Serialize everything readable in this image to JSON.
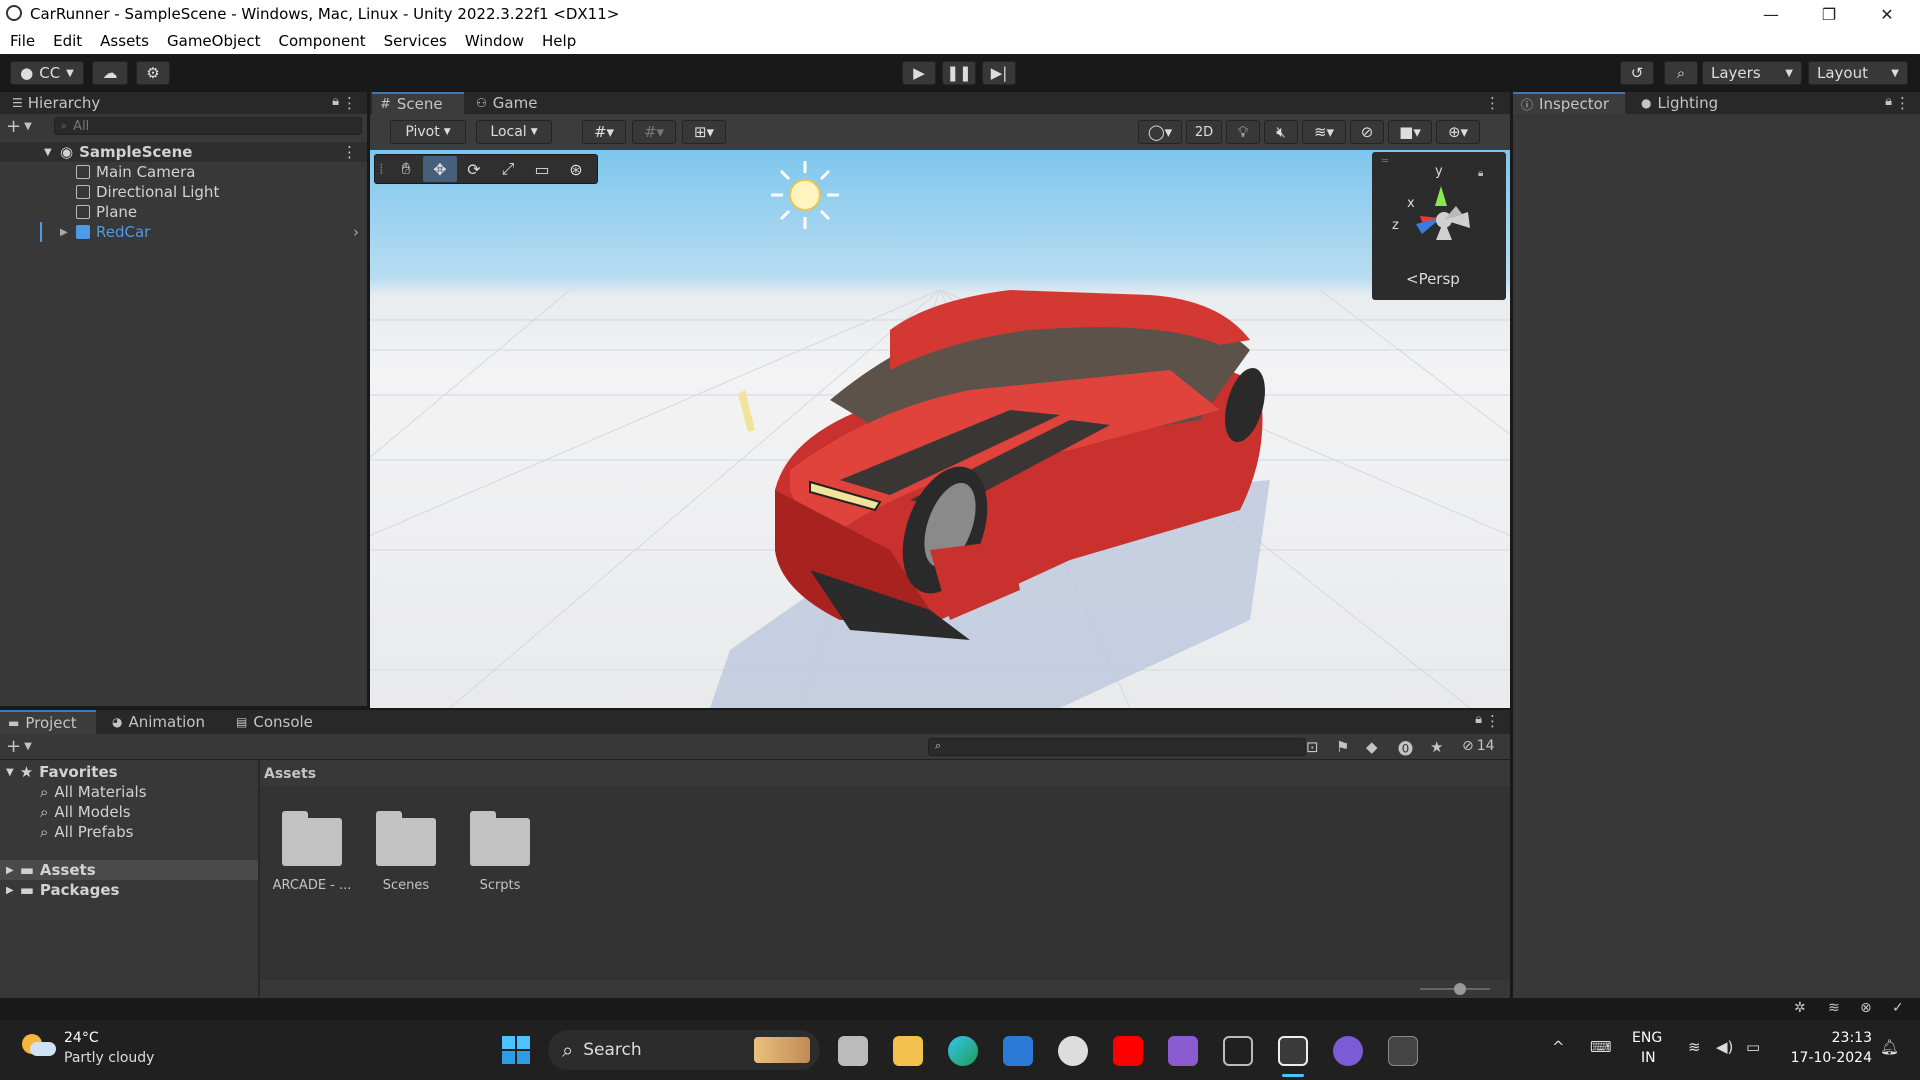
{
  "window": {
    "title": "CarRunner - SampleScene - Windows, Mac, Linux - Unity 2022.3.22f1 <DX11>",
    "minimize": "—",
    "maximize": "❐",
    "close": "✕"
  },
  "menu": [
    "File",
    "Edit",
    "Assets",
    "GameObject",
    "Component",
    "Services",
    "Window",
    "Help"
  ],
  "toolbar": {
    "account": "CC",
    "layers": "Layers",
    "layout": "Layout",
    "play_icon": "play-icon",
    "pause_icon": "pause-icon",
    "step_icon": "step-icon"
  },
  "hierarchy": {
    "tab": "Hierarchy",
    "search_placeholder": "All",
    "scene": "SampleScene",
    "items": [
      "Main Camera",
      "Directional Light",
      "Plane",
      "RedCar"
    ],
    "selected_color": "#4d9be6"
  },
  "scene_panel": {
    "tabs": [
      "Scene",
      "Game"
    ],
    "pivot": "Pivot",
    "local": "Local",
    "mode_2d": "2D",
    "gizmo": {
      "y": "y",
      "x": "x",
      "z": "z",
      "projection": "<Persp"
    }
  },
  "inspector": {
    "tabs": [
      "Inspector",
      "Lighting"
    ]
  },
  "project_panel": {
    "tabs": [
      "Project",
      "Animation",
      "Console"
    ],
    "favorites_label": "Favorites",
    "favorites": [
      "All Materials",
      "All Models",
      "All Prefabs"
    ],
    "tree": [
      "Assets",
      "Packages"
    ],
    "breadcrumb": "Assets",
    "folders": [
      "ARCADE - ...",
      "Scenes",
      "Scrpts"
    ],
    "hidden_count": "14"
  },
  "taskbar": {
    "weather_temp": "24°C",
    "weather_desc": "Partly cloudy",
    "search": "Search",
    "lang1": "ENG",
    "lang2": "IN",
    "time": "23:13",
    "date": "17-10-2024"
  }
}
